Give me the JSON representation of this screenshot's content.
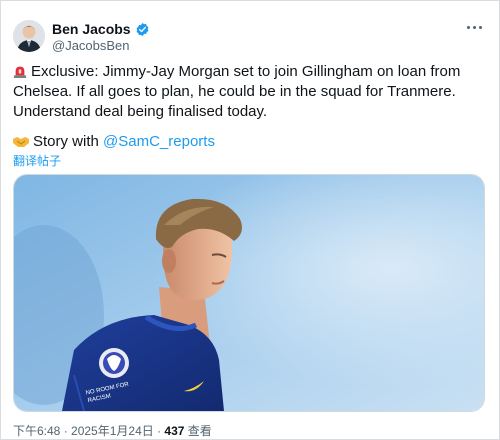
{
  "author": {
    "name": "Ben Jacobs",
    "handle": "@JacobsBen",
    "verified": true,
    "verified_color": "#1d9bf0"
  },
  "tweet": {
    "text": "Exclusive: Jimmy-Jay Morgan set to join Gillingham on loan from Chelsea. If all goes to plan, he could be in the squad for Tranmere. Understand deal being finalised today.",
    "leading_emoji": "siren-icon",
    "story_prefix": "Story with ",
    "story_emoji": "handshake-icon",
    "mention": "@SamC_reports",
    "translate_label": "翻译帖子"
  },
  "media": {
    "description_icon": "football-player-photo"
  },
  "meta": {
    "time": "下午6:48",
    "separator": " · ",
    "date": "2025年1月24日",
    "views": "437",
    "views_label": " 查看"
  },
  "colors": {
    "accent": "#1d9bf0",
    "text": "#0f1419",
    "secondary": "#536471"
  }
}
